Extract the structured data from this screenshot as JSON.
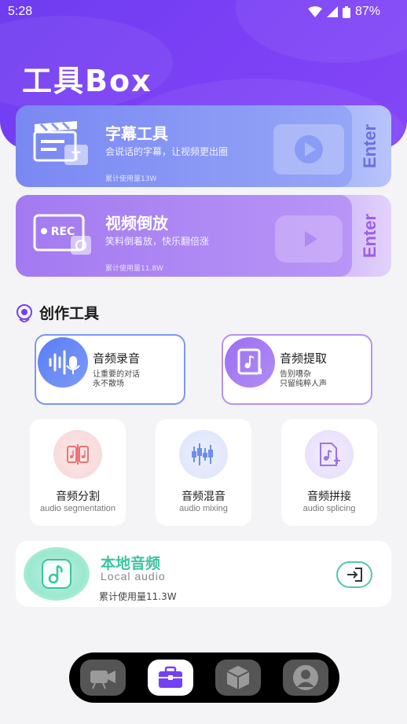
{
  "status": {
    "time": "5:28",
    "battery": "87%"
  },
  "app": {
    "title": "工具Box"
  },
  "cards": [
    {
      "title": "字幕工具",
      "subtitle": "会说话的字幕，让视频更出圈",
      "usage": "累计使用量13W",
      "enter": "Enter"
    },
    {
      "title": "视频倒放",
      "subtitle": "笑料倒着放，快乐翻倍涨",
      "usage": "累计使用量11.8W",
      "enter": "Enter"
    }
  ],
  "section": {
    "title": "创作工具"
  },
  "record_cards": [
    {
      "title": "音频录音",
      "sub1": "让重要的对话",
      "sub2": "永不散场"
    },
    {
      "title": "音频提取",
      "sub1": "告别嘈杂",
      "sub2": "只留纯粹人声"
    }
  ],
  "tools": [
    {
      "title": "音频分割",
      "sub": "audio segmentation"
    },
    {
      "title": "音频混音",
      "sub": "audio mixing"
    },
    {
      "title": "音频拼接",
      "sub": "audio splicing"
    }
  ],
  "local": {
    "title": "本地音频",
    "subtitle": "Local audio",
    "usage": "累计使用量11.3W"
  },
  "colors": {
    "accent": "#7440f3",
    "teal": "#3cc4a0",
    "blue_card": "#7c97f1",
    "purple_card": "#b692ee"
  },
  "nav": {
    "items": [
      "video-camera-icon",
      "toolbox-icon",
      "box-icon",
      "profile-icon"
    ],
    "active_index": 1
  }
}
